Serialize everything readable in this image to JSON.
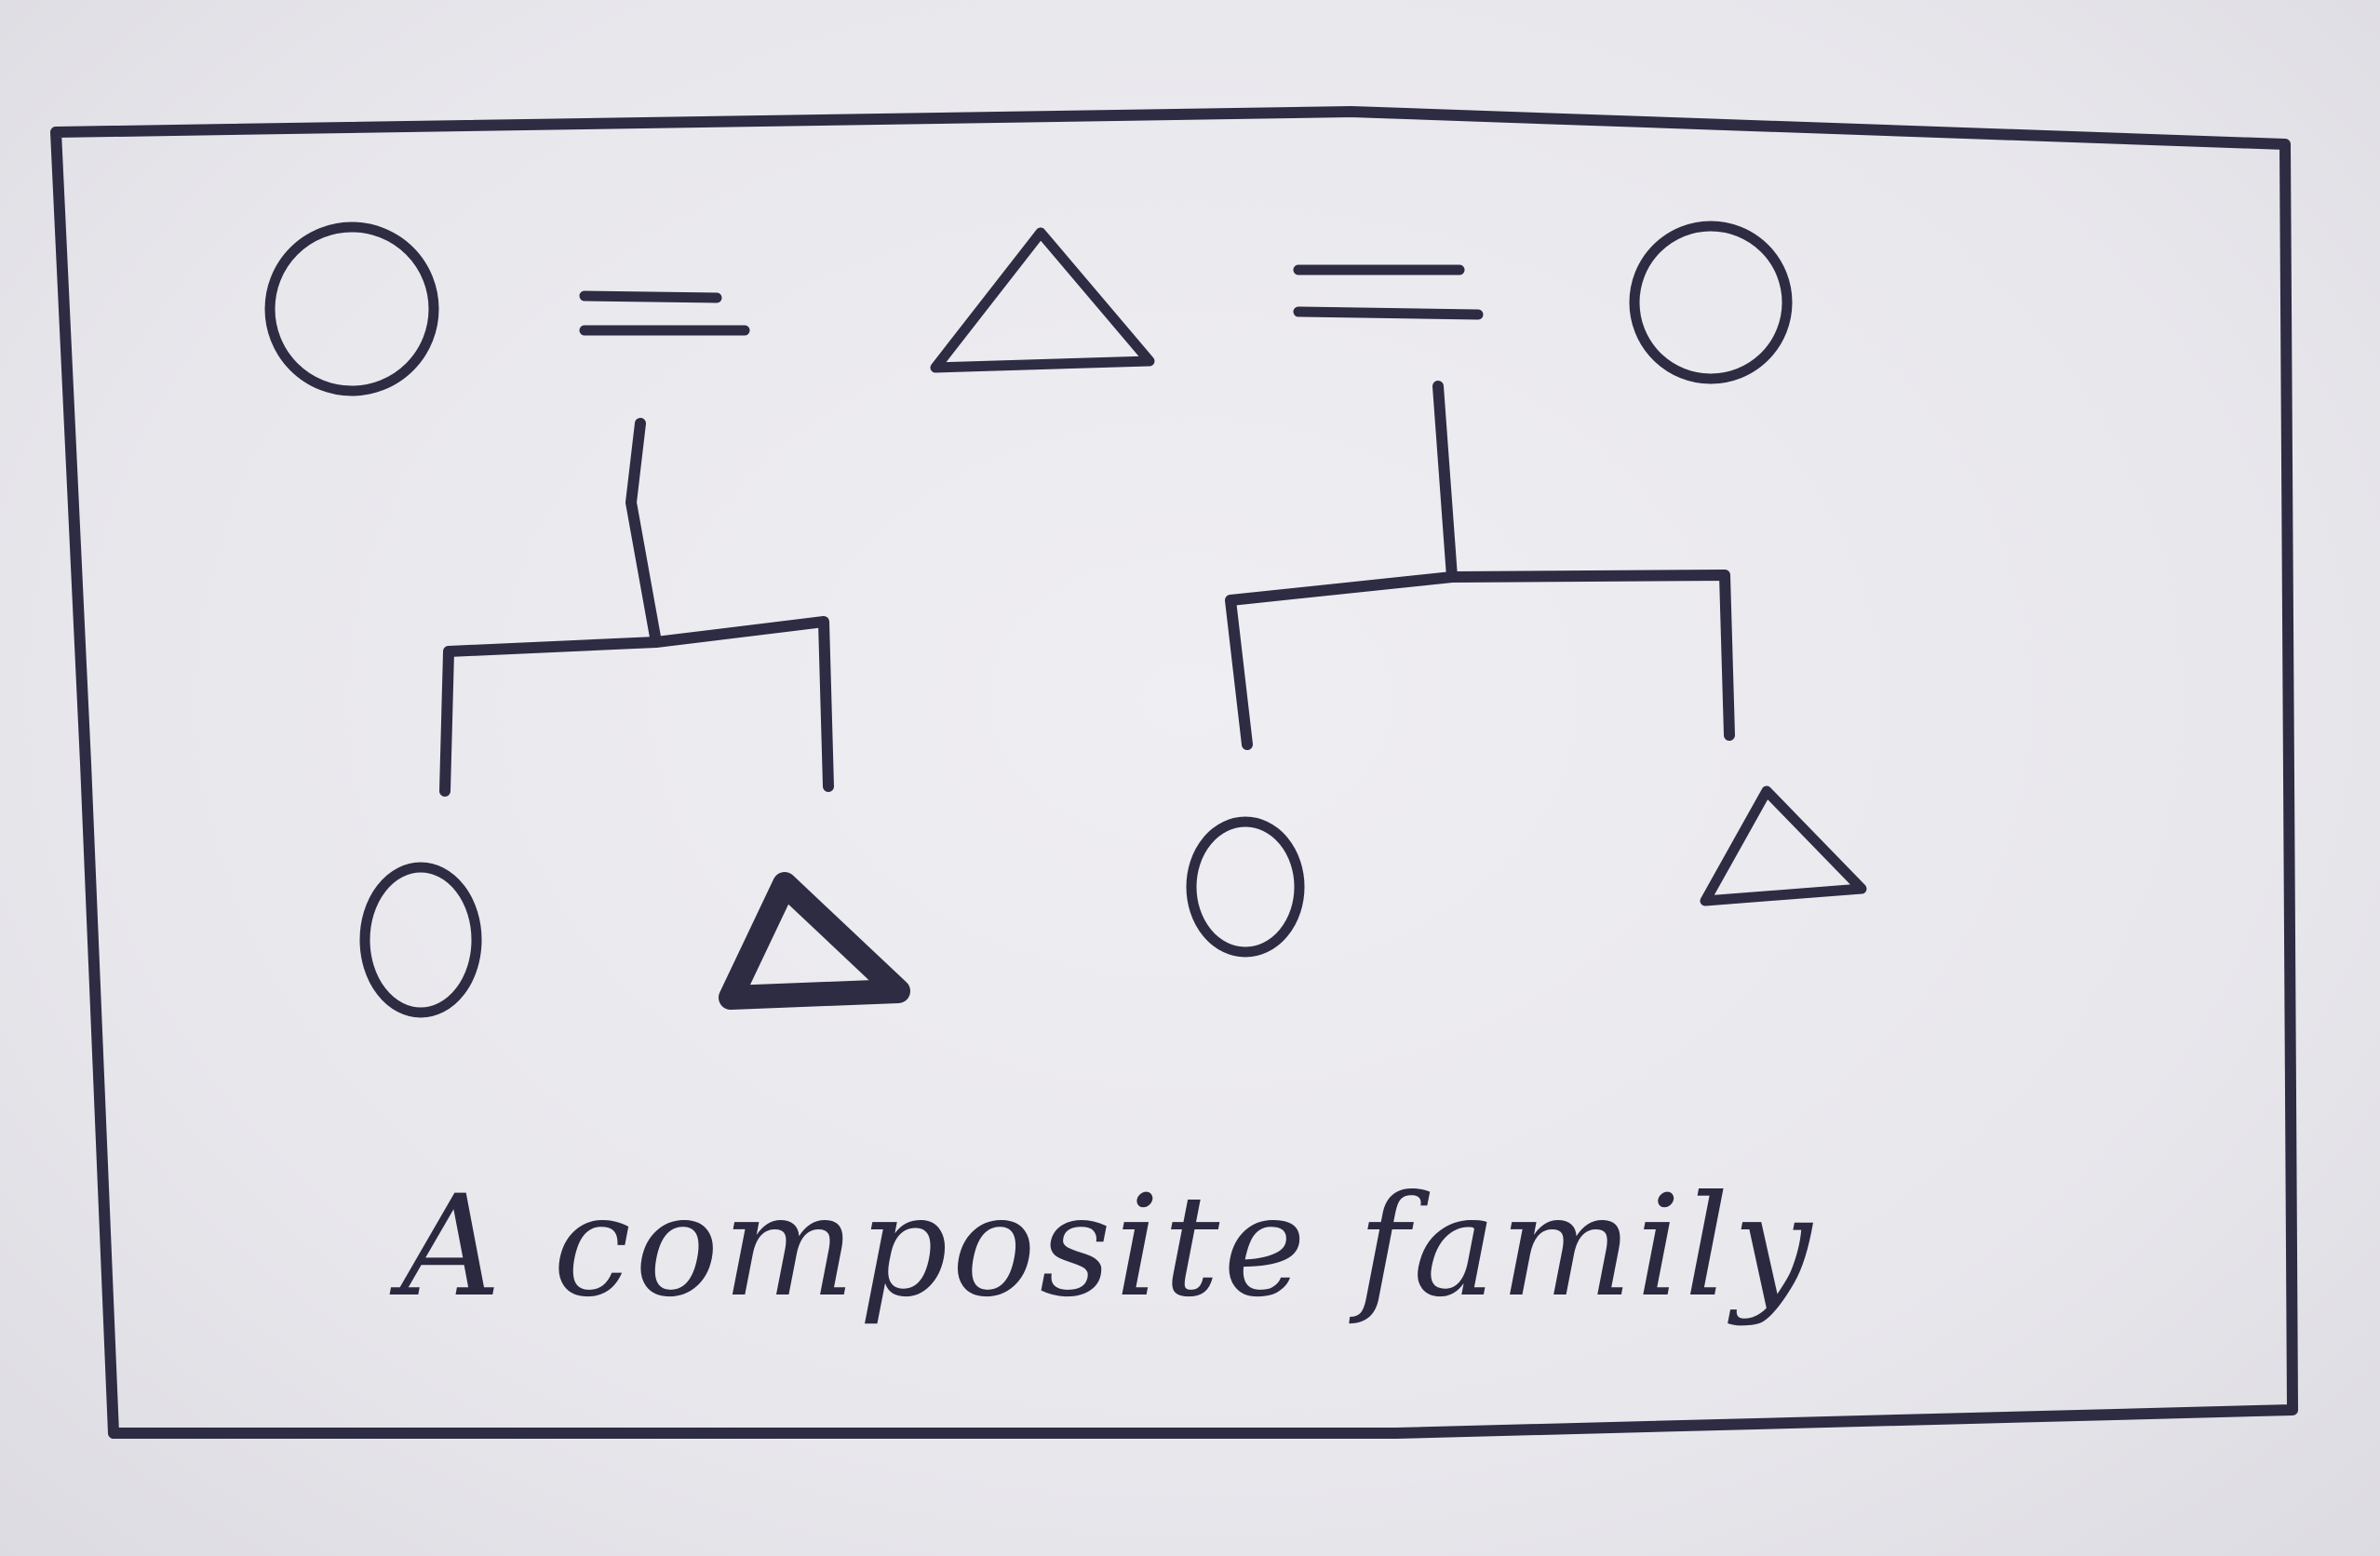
{
  "caption": "A composite family",
  "symbols": {
    "female": "circle",
    "male": "triangle",
    "marriage": "double-line",
    "highlighted_male": "filled-triangle"
  },
  "ink_color": "#2e2c43",
  "paper_color": "#e9e8ed"
}
